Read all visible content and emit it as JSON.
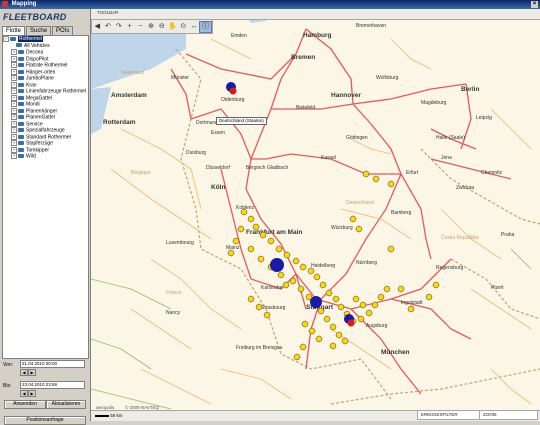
{
  "window": {
    "title": "Mapping"
  },
  "brand": {
    "logo_text": "FLEETBOARD"
  },
  "tabs": [
    {
      "label": "Flotte"
    },
    {
      "label": "Suche"
    },
    {
      "label": "POIs"
    }
  ],
  "tree": [
    {
      "label": "Rothermel",
      "selected": true,
      "expandable": true
    },
    {
      "label": "All Vehicles",
      "selected": false,
      "expandable": false
    },
    {
      "label": "Decona",
      "selected": false,
      "expandable": true
    },
    {
      "label": "DispoPilot",
      "selected": false,
      "expandable": true
    },
    {
      "label": "Flatrate Rothermel",
      "selected": false,
      "expandable": true
    },
    {
      "label": "Hänger-orten",
      "selected": false,
      "expandable": true
    },
    {
      "label": "JumboPlane",
      "selected": false,
      "expandable": true
    },
    {
      "label": "Kran",
      "selected": false,
      "expandable": true
    },
    {
      "label": "Linienfahrzeuge Rothermel",
      "selected": false,
      "expandable": true
    },
    {
      "label": "MegaGattel",
      "selected": false,
      "expandable": true
    },
    {
      "label": "Mondi",
      "selected": false,
      "expandable": true
    },
    {
      "label": "Planenhänger",
      "selected": false,
      "expandable": true
    },
    {
      "label": "PlanenGattel",
      "selected": false,
      "expandable": true
    },
    {
      "label": "Service",
      "selected": false,
      "expandable": true
    },
    {
      "label": "Spezialfahrzeuge",
      "selected": false,
      "expandable": true
    },
    {
      "label": "Standard Rothermel",
      "selected": false,
      "expandable": true
    },
    {
      "label": "Stapferzüge",
      "selected": false,
      "expandable": true
    },
    {
      "label": "Tomkipper",
      "selected": false,
      "expandable": true
    },
    {
      "label": "Wild",
      "selected": false,
      "expandable": true
    }
  ],
  "dates": {
    "from_label": "Von:",
    "from_value": "21.04.2010 00:00",
    "to_label": "Bis:",
    "to_value": "23.04.2010 23:59"
  },
  "buttons": {
    "apply": "Anwenden",
    "refresh": "Aktualisieren",
    "position_request": "Positionsanfrage"
  },
  "map": {
    "toolbar_label": "TOOLBAR",
    "tools": [
      "◀",
      "↶",
      "↷",
      "+",
      "−",
      "⊕",
      "⊖",
      "✋",
      "⊙",
      "↔",
      "ⓘ"
    ],
    "tooltip": "Deutschland (Staaten)",
    "scale": "50 km",
    "credit": "aeropolis",
    "copyright": "© 2009 NAVTEQ",
    "status_left": "EREIGNISFILTER",
    "status_right": "ZOOM"
  },
  "cities": [
    {
      "name": "Hamburg"
    },
    {
      "name": "Bremen"
    },
    {
      "name": "Hannover"
    },
    {
      "name": "Berlin"
    },
    {
      "name": "Amsterdam"
    },
    {
      "name": "Rotterdam"
    },
    {
      "name": "Emden"
    },
    {
      "name": "Oldenburg"
    },
    {
      "name": "Bielefeld"
    },
    {
      "name": "Wolfsburg"
    },
    {
      "name": "Magdeburg"
    },
    {
      "name": "Göttingen"
    },
    {
      "name": "Kassel"
    },
    {
      "name": "Halle (Saale)"
    },
    {
      "name": "Leipzig"
    },
    {
      "name": "Essen"
    },
    {
      "name": "Duisburg"
    },
    {
      "name": "Düsseldorf"
    },
    {
      "name": "Köln"
    },
    {
      "name": "Bergisch Gladbach"
    },
    {
      "name": "Koblenz"
    },
    {
      "name": "Frankfurt am Main"
    },
    {
      "name": "Erfurt"
    },
    {
      "name": "Jena"
    },
    {
      "name": "Deutschland"
    },
    {
      "name": "Luxembourg"
    },
    {
      "name": "Heidelberg"
    },
    {
      "name": "Nürnberg"
    },
    {
      "name": "Karlsruhe"
    },
    {
      "name": "Stuttgart"
    },
    {
      "name": "Strasbourg"
    },
    {
      "name": "Regensburg"
    },
    {
      "name": "Ingolstadt"
    },
    {
      "name": "München"
    },
    {
      "name": "Augsburg"
    },
    {
      "name": "Freiburg im Breisgau"
    },
    {
      "name": "Nancy"
    },
    {
      "name": "France"
    },
    {
      "name": "Česká Republika"
    },
    {
      "name": "Praha"
    },
    {
      "name": "Belgique"
    },
    {
      "name": "Nederland"
    },
    {
      "name": "Plzeň"
    },
    {
      "name": "Bremerhaven"
    },
    {
      "name": "Würzburg"
    },
    {
      "name": "Bamberg"
    },
    {
      "name": "Mainz"
    },
    {
      "name": "Chemnitz"
    },
    {
      "name": "Zwickau"
    },
    {
      "name": "Dortmund"
    },
    {
      "name": "Münster"
    }
  ]
}
